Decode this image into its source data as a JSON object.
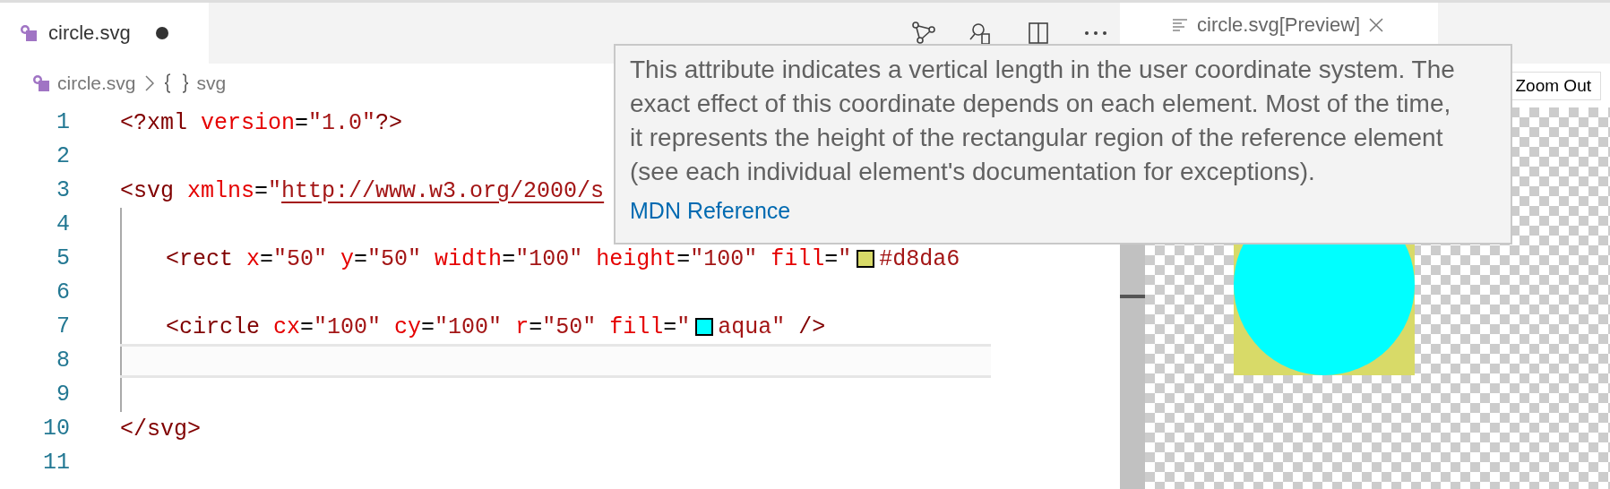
{
  "editor_tab": {
    "label": "circle.svg",
    "modified": true
  },
  "breadcrumb": [
    {
      "kind": "file",
      "label": "circle.svg"
    },
    {
      "kind": "element",
      "label": "svg"
    }
  ],
  "code_lines": [
    {
      "number": "1",
      "current": false,
      "guide": false,
      "indented": false,
      "tokens": [
        {
          "kind": "tag",
          "text": "<?xml"
        },
        {
          "kind": "attr",
          "text": " version"
        },
        {
          "kind": "punct",
          "text": "="
        },
        {
          "kind": "value",
          "text": "\"1.0\""
        },
        {
          "kind": "tag",
          "text": "?>"
        }
      ]
    },
    {
      "number": "2",
      "current": false,
      "guide": false
    },
    {
      "number": "3",
      "current": false,
      "guide": false,
      "indented": false,
      "tokens": [
        {
          "kind": "tag",
          "text": "<svg"
        },
        {
          "kind": "attr",
          "text": " xmlns"
        },
        {
          "kind": "punct",
          "text": "="
        },
        {
          "kind": "value",
          "text": "\""
        },
        {
          "kind": "link",
          "text": "http://www.w3.org/2000/s"
        }
      ]
    },
    {
      "number": "4",
      "current": false,
      "guide": true
    },
    {
      "number": "5",
      "current": false,
      "guide": true,
      "indented": true,
      "tokens": [
        {
          "kind": "tag",
          "text": "<rect"
        },
        {
          "kind": "attr",
          "text": " x"
        },
        {
          "kind": "punct",
          "text": "="
        },
        {
          "kind": "value",
          "text": "\"50\""
        },
        {
          "kind": "attr",
          "text": " y"
        },
        {
          "kind": "punct",
          "text": "="
        },
        {
          "kind": "value",
          "text": "\"50\""
        },
        {
          "kind": "attr",
          "text": " width"
        },
        {
          "kind": "punct",
          "text": "="
        },
        {
          "kind": "value",
          "text": "\"100\""
        },
        {
          "kind": "attr",
          "text": " height"
        },
        {
          "kind": "punct",
          "text": "="
        },
        {
          "kind": "value",
          "text": "\"100\""
        },
        {
          "kind": "attr",
          "text": " fill"
        },
        {
          "kind": "punct",
          "text": "="
        },
        {
          "kind": "value",
          "text": "\""
        },
        {
          "kind": "swatch",
          "color": "#d8da68"
        },
        {
          "kind": "value",
          "text": "#d8da6"
        }
      ]
    },
    {
      "number": "6",
      "current": false,
      "guide": true
    },
    {
      "number": "7",
      "current": false,
      "guide": true,
      "indented": true,
      "tokens": [
        {
          "kind": "tag",
          "text": "<circle"
        },
        {
          "kind": "attr",
          "text": " cx"
        },
        {
          "kind": "punct",
          "text": "="
        },
        {
          "kind": "value",
          "text": "\"100\""
        },
        {
          "kind": "attr",
          "text": " cy"
        },
        {
          "kind": "punct",
          "text": "="
        },
        {
          "kind": "value",
          "text": "\"100\""
        },
        {
          "kind": "attr",
          "text": " r"
        },
        {
          "kind": "punct",
          "text": "="
        },
        {
          "kind": "value",
          "text": "\"50\""
        },
        {
          "kind": "attr",
          "text": " fill"
        },
        {
          "kind": "punct",
          "text": "="
        },
        {
          "kind": "value",
          "text": "\""
        },
        {
          "kind": "swatch",
          "color": "#00ffff"
        },
        {
          "kind": "value",
          "text": "aqua\""
        },
        {
          "kind": "tag",
          "text": " />"
        }
      ]
    },
    {
      "number": "8",
      "current": true,
      "guide": true
    },
    {
      "number": "9",
      "current": false,
      "guide": true
    },
    {
      "number": "10",
      "current": false,
      "guide": false,
      "indented": false,
      "tokens": [
        {
          "kind": "tag",
          "text": "</svg>"
        }
      ]
    },
    {
      "number": "11",
      "current": false,
      "guide": false
    }
  ],
  "preview_tab": {
    "label": "circle.svg[Preview]"
  },
  "preview_toolbar": {
    "button": "Zoom Out"
  },
  "tooltip": {
    "text": "This attribute indicates a vertical length in the user coordinate system. The exact effect of this coordinate depends on each element. Most of the time, it represents the height of the rectangular region of the reference element (see each individual element's documentation for exceptions).",
    "link": "MDN Reference"
  }
}
